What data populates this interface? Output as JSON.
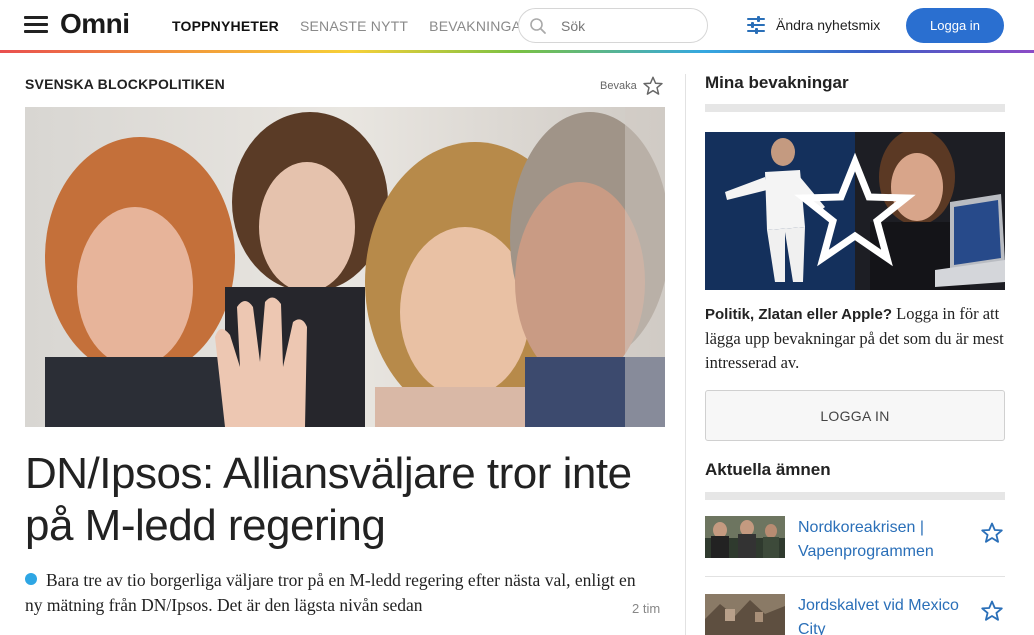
{
  "header": {
    "logo": "Omni",
    "nav": [
      {
        "label": "TOPPNYHETER",
        "active": true
      },
      {
        "label": "SENASTE NYTT",
        "active": false
      },
      {
        "label": "BEVAKNINGAR",
        "active": false
      }
    ],
    "search": {
      "placeholder": "Sök",
      "icon": "search-icon"
    },
    "mix": {
      "label": "Ändra nyhetsmix",
      "icon": "sliders-icon"
    },
    "login_label": "Logga in"
  },
  "article": {
    "topic": "SVENSKA BLOCKPOLITIKEN",
    "follow_label": "Bevaka",
    "headline": "DN/Ipsos: Alliansväljare tror inte på M-ledd regering",
    "lead": "Bara tre av tio borgerliga väljare tror på en M-ledd regering efter nästa val, enligt en ny mätning från DN/Ipsos. Det är den lägsta nivån sedan",
    "time": "2 tim"
  },
  "sidebar": {
    "title": "Mina bevakningar",
    "promo_bold": "Politik, Zlatan eller Apple?",
    "promo_text": " Logga in för att lägga upp bevakningar på det som du är mest intresserad av.",
    "login_label": "LOGGA IN",
    "topics_title": "Aktuella ämnen",
    "topics": [
      {
        "label": "Nordkoreakrisen | Vapenprogrammen"
      },
      {
        "label": "Jordskalvet vid Mexico City"
      }
    ]
  },
  "colors": {
    "accent": "#2a6fd0",
    "link": "#2a6fb8",
    "bullet": "#2ea6e4"
  }
}
